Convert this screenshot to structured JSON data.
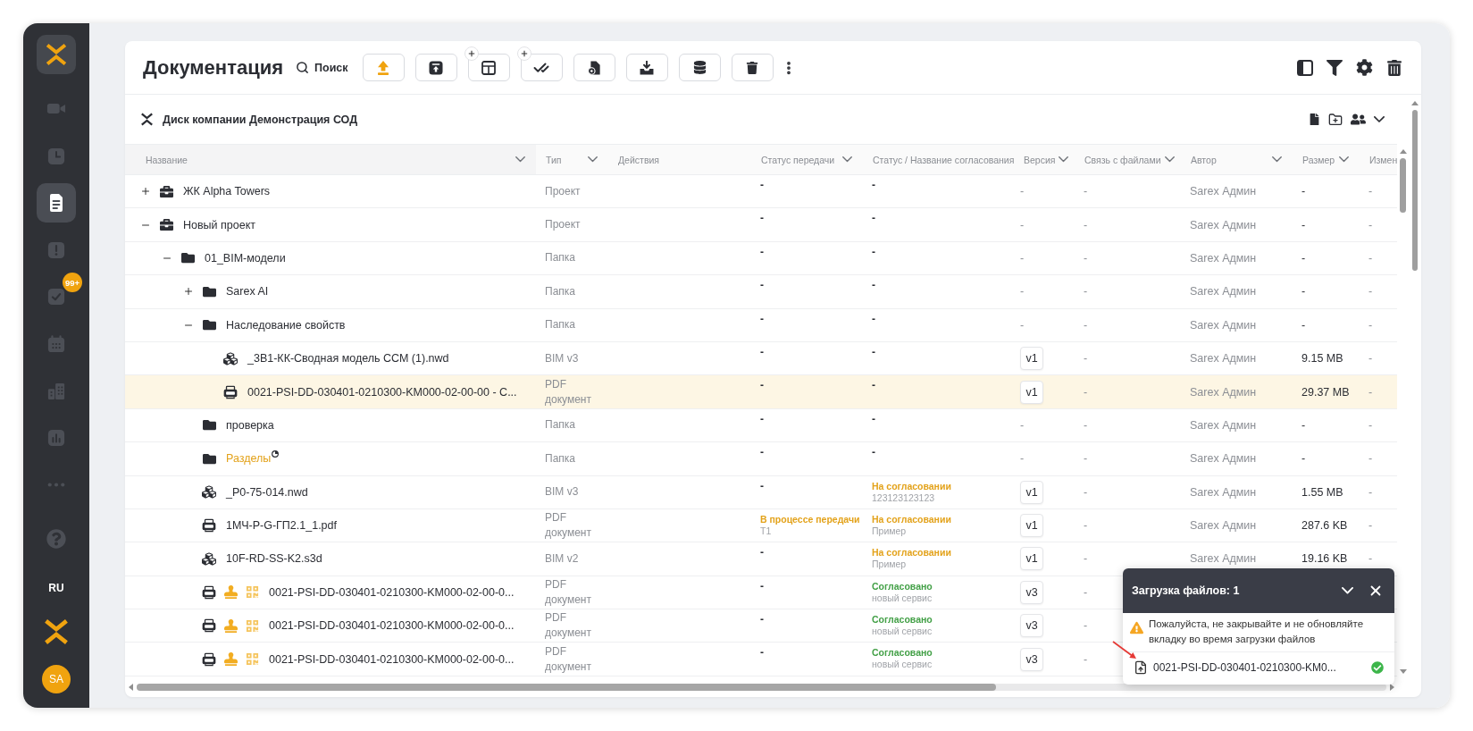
{
  "sidebar": {
    "nav": [
      {
        "kind": "video",
        "selected": false
      },
      {
        "kind": "clock",
        "selected": false
      },
      {
        "kind": "documents",
        "selected": true
      },
      {
        "kind": "alert",
        "selected": false
      },
      {
        "kind": "tasks",
        "selected": false,
        "badge": "99+"
      },
      {
        "kind": "calendar",
        "selected": false
      },
      {
        "kind": "buildings",
        "selected": false
      },
      {
        "kind": "reports",
        "selected": false
      },
      {
        "kind": "more",
        "selected": false
      }
    ],
    "language": "RU",
    "avatar": "SA"
  },
  "header": {
    "title": "Документация",
    "search_label": "Поиск",
    "toolbar": [
      {
        "kind": "upload",
        "add_badge": false
      },
      {
        "kind": "publish",
        "add_badge": false
      },
      {
        "kind": "layout",
        "add_badge": true
      },
      {
        "kind": "approve",
        "add_badge": true
      },
      {
        "kind": "bim",
        "add_badge": false
      },
      {
        "kind": "import",
        "add_badge": false
      },
      {
        "kind": "database",
        "add_badge": false
      },
      {
        "kind": "delete",
        "add_badge": false
      }
    ]
  },
  "disk": {
    "title": "Диск компании Демонстрация СОД"
  },
  "table": {
    "columns": [
      {
        "label": "Название",
        "dropdown": true
      },
      {
        "label": "Тип",
        "dropdown": true
      },
      {
        "label": "Действия",
        "dropdown": false
      },
      {
        "label": "Статус передачи",
        "dropdown": true
      },
      {
        "label": "Статус / Название согласования"
      },
      {
        "label": "Версия",
        "dropdown": true
      },
      {
        "label": "Связь с файлами",
        "dropdown": true
      },
      {
        "label": "Автор",
        "dropdown": true
      },
      {
        "label": "Размер",
        "dropdown": true
      },
      {
        "label": "Измен"
      }
    ],
    "rows": [
      {
        "name": "ЖК Alpha Towers",
        "kind": "project",
        "expanded": false,
        "selected": false,
        "hovered": false,
        "signed": false,
        "type": "Проект",
        "transfer": {
          "status": "-",
          "kind": "empty"
        },
        "approval": {
          "status": "-",
          "kind": "empty"
        },
        "version": {
          "label": "-",
          "badge": false
        },
        "links": "-",
        "author": "Sarex Админ",
        "size": "-",
        "modified": "-"
      },
      {
        "name": "Новый проект",
        "kind": "project",
        "expanded": true,
        "selected": false,
        "hovered": false,
        "signed": false,
        "type": "Проект",
        "transfer": {
          "status": "-",
          "kind": "empty"
        },
        "approval": {
          "status": "-",
          "kind": "empty"
        },
        "version": {
          "label": "-",
          "badge": false
        },
        "links": "-",
        "author": "Sarex Админ",
        "size": "-",
        "modified": "-",
        "children": [
          {
            "name": "01_BIM-модели",
            "kind": "folder",
            "expanded": true,
            "selected": false,
            "hovered": false,
            "signed": false,
            "type": "Папка",
            "transfer": {
              "status": "-",
              "kind": "empty"
            },
            "approval": {
              "status": "-",
              "kind": "empty"
            },
            "version": {
              "label": "-",
              "badge": false
            },
            "links": "-",
            "author": "Sarex Админ",
            "size": "-",
            "modified": "-",
            "children": [
              {
                "name": "Sarex AI",
                "kind": "folder",
                "expanded": false,
                "selected": false,
                "hovered": false,
                "signed": false,
                "type": "Папка",
                "transfer": {
                  "status": "-",
                  "kind": "empty"
                },
                "approval": {
                  "status": "-",
                  "kind": "empty"
                },
                "version": {
                  "label": "-",
                  "badge": false
                },
                "links": "-",
                "author": "Sarex Админ",
                "size": "-",
                "modified": "-"
              },
              {
                "name": "Наследование свойств",
                "kind": "folder",
                "expanded": true,
                "selected": false,
                "hovered": false,
                "signed": false,
                "type": "Папка",
                "transfer": {
                  "status": "-",
                  "kind": "empty"
                },
                "approval": {
                  "status": "-",
                  "kind": "empty"
                },
                "version": {
                  "label": "-",
                  "badge": false
                },
                "links": "-",
                "author": "Sarex Админ",
                "size": "-",
                "modified": "-",
                "children": [
                  {
                    "name": "_3B1-КК-Сводная модель ССМ (1).nwd",
                    "kind": "bim",
                    "selected": false,
                    "hovered": false,
                    "signed": false,
                    "type": "BIM v3",
                    "transfer": {
                      "status": "-",
                      "kind": "empty"
                    },
                    "approval": {
                      "status": "-",
                      "kind": "empty"
                    },
                    "version": {
                      "label": "v1",
                      "badge": true
                    },
                    "links": "-",
                    "author": "Sarex Админ",
                    "size": "9.15 MB",
                    "modified": "-"
                  },
                  {
                    "name": "0021-PSI-DD-030401-0210300-KM000-02-00-00 - C...",
                    "kind": "pdf",
                    "selected": true,
                    "hovered": false,
                    "signed": false,
                    "type": "PDF документ",
                    "transfer": {
                      "status": "-",
                      "kind": "empty"
                    },
                    "approval": {
                      "status": "-",
                      "kind": "empty"
                    },
                    "version": {
                      "label": "v1",
                      "badge": true
                    },
                    "links": "-",
                    "author": "Sarex Админ",
                    "size": "29.37 MB",
                    "modified": "-"
                  }
                ]
              },
              {
                "name": "проверка",
                "kind": "folder",
                "selected": false,
                "hovered": false,
                "signed": false,
                "type": "Папка",
                "transfer": {
                  "status": "-",
                  "kind": "empty"
                },
                "approval": {
                  "status": "-",
                  "kind": "empty"
                },
                "version": {
                  "label": "-",
                  "badge": false
                },
                "links": "-",
                "author": "Sarex Админ",
                "size": "-",
                "modified": "-"
              },
              {
                "name": "Разделы",
                "kind": "folder",
                "selected": false,
                "hovered": true,
                "signed": false,
                "type": "Папка",
                "transfer": {
                  "status": "-",
                  "kind": "empty"
                },
                "approval": {
                  "status": "-",
                  "kind": "empty"
                },
                "version": {
                  "label": "-",
                  "badge": false
                },
                "links": "-",
                "author": "Sarex Админ",
                "size": "-",
                "modified": "-"
              },
              {
                "name": "_P0-75-014.nwd",
                "kind": "bim",
                "selected": false,
                "hovered": false,
                "signed": false,
                "type": "BIM v3",
                "transfer": {
                  "status": "-",
                  "kind": "empty"
                },
                "approval": {
                  "status": "На согласовании",
                  "detail": "123123123123",
                  "kind": "pending"
                },
                "version": {
                  "label": "v1",
                  "badge": true
                },
                "links": "-",
                "author": "Sarex Админ",
                "size": "1.55 MB",
                "modified": "-"
              },
              {
                "name": "1МЧ-Р-G-ГП2.1_1.pdf",
                "kind": "pdf",
                "selected": false,
                "hovered": false,
                "signed": false,
                "type": "PDF документ",
                "transfer": {
                  "status": "В процессе передачи",
                  "detail": "T1",
                  "kind": "progress"
                },
                "approval": {
                  "status": "На согласовании",
                  "detail": "Пример",
                  "kind": "pending"
                },
                "version": {
                  "label": "v1",
                  "badge": true
                },
                "links": "-",
                "author": "Sarex Админ",
                "size": "287.6 KB",
                "modified": "-"
              },
              {
                "name": "10F-RD-SS-K2.s3d",
                "kind": "bim",
                "selected": false,
                "hovered": false,
                "signed": false,
                "type": "BIM v2",
                "transfer": {
                  "status": "-",
                  "kind": "empty"
                },
                "approval": {
                  "status": "На согласовании",
                  "detail": "Пример",
                  "kind": "pending"
                },
                "version": {
                  "label": "v1",
                  "badge": true
                },
                "links": "-",
                "author": "Sarex Админ",
                "size": "19.16 KB",
                "modified": "-"
              },
              {
                "name": "0021-PSI-DD-030401-0210300-KM000-02-00-0...",
                "kind": "pdf",
                "selected": false,
                "hovered": false,
                "signed": true,
                "type": "PDF документ",
                "transfer": {
                  "status": "-",
                  "kind": "empty"
                },
                "approval": {
                  "status": "Согласовано",
                  "detail": "новый сервис",
                  "kind": "approved"
                },
                "version": {
                  "label": "v3",
                  "badge": true
                },
                "links": "-"
              },
              {
                "name": "0021-PSI-DD-030401-0210300-KM000-02-00-0...",
                "kind": "pdf",
                "selected": false,
                "hovered": false,
                "signed": true,
                "type": "PDF документ",
                "transfer": {
                  "status": "-",
                  "kind": "empty"
                },
                "approval": {
                  "status": "Согласовано",
                  "detail": "новый сервис",
                  "kind": "approved"
                },
                "version": {
                  "label": "v3",
                  "badge": true
                },
                "links": "-"
              },
              {
                "name": "0021-PSI-DD-030401-0210300-KM000-02-00-0...",
                "kind": "pdf",
                "selected": false,
                "hovered": false,
                "signed": true,
                "type": "PDF документ",
                "transfer": {
                  "status": "-",
                  "kind": "empty"
                },
                "approval": {
                  "status": "Согласовано",
                  "detail": "новый сервис",
                  "kind": "approved"
                },
                "version": {
                  "label": "v3",
                  "badge": true
                },
                "links": "-"
              }
            ]
          }
        ]
      }
    ]
  },
  "upload_panel": {
    "title": "Загрузка файлов: 1",
    "warning": "Пожалуйста, не закрывайте и не обновляйте вкладку во время загрузки файлов",
    "files": [
      {
        "name": "0021-PSI-DD-030401-0210300-KM0...",
        "done": true
      }
    ]
  }
}
